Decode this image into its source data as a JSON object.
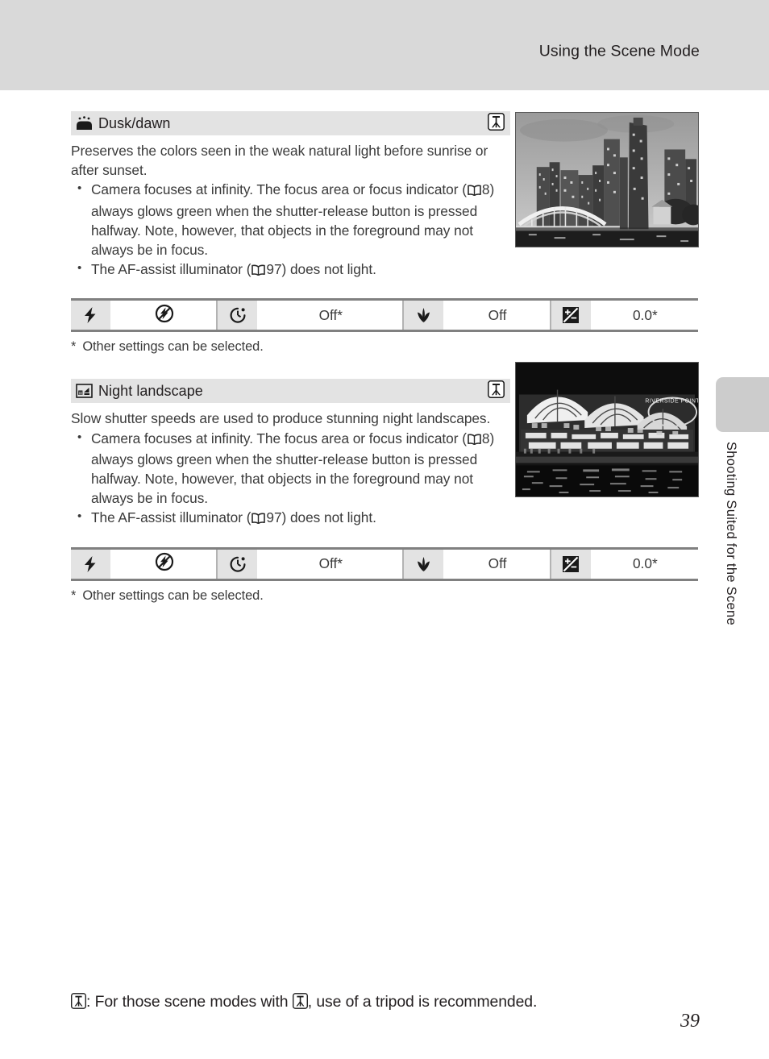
{
  "header": {
    "title": "Using the Scene Mode"
  },
  "side_tab": {
    "label": "Shooting Suited for the Scene"
  },
  "sections": [
    {
      "id": "dusk-dawn",
      "icon_name": "dusk-dawn-scene-icon",
      "title": "Dusk/dawn",
      "tripod_badge": "tripod-icon",
      "intro": "Preserves the colors seen in the weak natural light before sunrise or after sunset.",
      "bullets": [
        {
          "pre": "Camera focuses at infinity. The focus area or focus indicator (",
          "ref_page": "8",
          "post": ") always glows green when the shutter-release button is pressed halfway. Note, however, that objects in the foreground may not always be in focus."
        },
        {
          "pre": "The AF-assist illuminator (",
          "ref_page": "97",
          "post": ") does not light."
        }
      ],
      "settings": {
        "flash_icon": "flash-icon",
        "flash_value_icon": "flash-off-icon",
        "selftimer_icon": "self-timer-icon",
        "selftimer_value": "Off*",
        "macro_icon": "macro-icon",
        "macro_value": "Off",
        "exposure_icon": "exposure-compensation-icon",
        "exposure_value": "0.0*"
      },
      "footnote_star": "*",
      "footnote": "Other settings can be selected.",
      "photo_alt": "dusk-cityscape-photo"
    },
    {
      "id": "night-landscape",
      "icon_name": "night-landscape-scene-icon",
      "title": "Night landscape",
      "tripod_badge": "tripod-icon",
      "intro": "Slow shutter speeds are used to produce stunning night landscapes.",
      "bullets": [
        {
          "pre": "Camera focuses at infinity. The focus area or focus indicator (",
          "ref_page": "8",
          "post": ") always glows green when the shutter-release button is pressed halfway. Note, however, that objects in the foreground may not always be in focus."
        },
        {
          "pre": "The AF-assist illuminator (",
          "ref_page": "97",
          "post": ") does not light."
        }
      ],
      "settings": {
        "flash_icon": "flash-icon",
        "flash_value_icon": "flash-off-icon",
        "selftimer_icon": "self-timer-icon",
        "selftimer_value": "Off*",
        "macro_icon": "macro-icon",
        "macro_value": "Off",
        "exposure_icon": "exposure-compensation-icon",
        "exposure_value": "0.0*"
      },
      "footnote_star": "*",
      "footnote": "Other settings can be selected.",
      "photo_alt": "night-riverside-photo"
    }
  ],
  "bottom_note": {
    "prefix": ": For those scene modes with ",
    "suffix": ", use of a tripod is recommended."
  },
  "page_number": "39",
  "colors": {
    "header_band": "#d9d9d9",
    "section_header": "#e3e3e3",
    "table_rule": "#808080",
    "thumb_tab": "#cccccc",
    "text": "#231f20"
  }
}
